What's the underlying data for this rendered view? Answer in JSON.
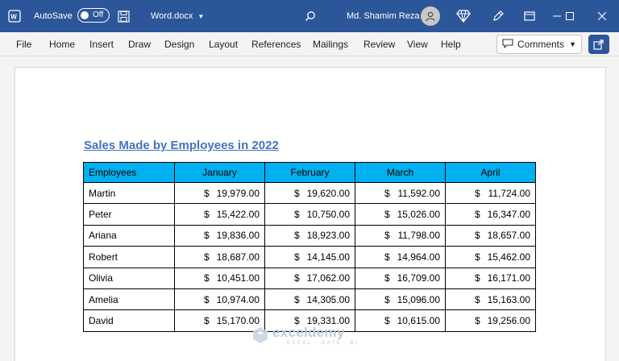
{
  "titlebar": {
    "autosave_label": "AutoSave",
    "autosave_state": "Off",
    "doc_name": "Word.docx",
    "user_name": "Md. Shamim Reza",
    "colors": {
      "bar": "#2b579a"
    }
  },
  "ribbon": {
    "tabs": [
      "File",
      "Home",
      "Insert",
      "Draw",
      "Design",
      "Layout",
      "References",
      "Mailings",
      "Review",
      "View",
      "Help"
    ],
    "comments_label": "Comments"
  },
  "document": {
    "title": "Sales Made by Employees in 2022",
    "table": {
      "headers": [
        "Employees",
        "January",
        "February",
        "March",
        "April"
      ],
      "currency": "$",
      "rows": [
        [
          "Martin",
          "19,979.00",
          "19,620.00",
          "11,592.00",
          "11,724.00"
        ],
        [
          "Peter",
          "15,422.00",
          "10,750.00",
          "15,026.00",
          "16,347.00"
        ],
        [
          "Ariana",
          "19,836.00",
          "18,923.00",
          "11,798.00",
          "18,657.00"
        ],
        [
          "Robert",
          "18,687.00",
          "14,145.00",
          "14,964.00",
          "15,462.00"
        ],
        [
          "Olivia",
          "10,451.00",
          "17,062.00",
          "16,709.00",
          "16,171.00"
        ],
        [
          "Amelia",
          "10,974.00",
          "14,305.00",
          "15,096.00",
          "15,163.00"
        ],
        [
          "David",
          "15,170.00",
          "19,331.00",
          "10,615.00",
          "19,256.00"
        ]
      ],
      "header_color": "#00b0f0"
    }
  },
  "watermark": {
    "name": "exceldemy",
    "tagline": "EXCEL · DATA · BI"
  }
}
